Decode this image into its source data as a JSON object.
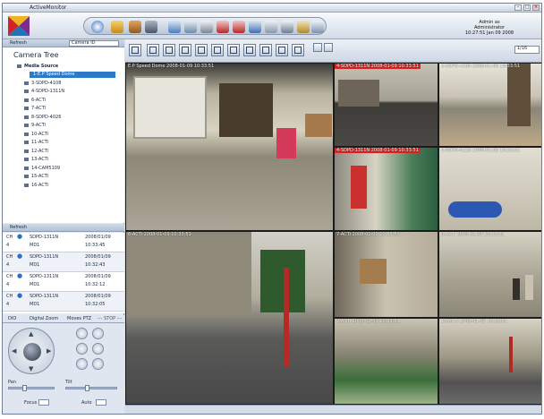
{
  "app": {
    "title": "ActiveMonitor"
  },
  "header": {
    "admin_line1": "Admin as Administrator",
    "admin_line2": "10:27:51 Jan 09 2008"
  },
  "sidebar": {
    "refresh_label": "Refresh",
    "camera_select": "Camera ID",
    "tree_title": "Camera Tree",
    "tree": [
      "Media Source",
      "1-E.P Speed Dome",
      "3-SDPD-4108",
      "4-SDPD-1311N",
      "6-ACTi",
      "7-ACTi",
      "8-SDPD-4026",
      "9-ACTi",
      "10-ACTi",
      "11-ACTi",
      "12-ACTi",
      "13-ACTi",
      "14-CAM5109",
      "15-ACTi",
      "16-ACTi"
    ]
  },
  "events": {
    "refresh_label": "Refresh",
    "rows": [
      {
        "ch": "CH",
        "name": "SDPD-1311N",
        "date": "2008/01/09",
        "num": "4",
        "md": "MD1",
        "time": "10:33:45"
      },
      {
        "ch": "CH",
        "name": "SDPD-1311N",
        "date": "2008/01/09",
        "num": "4",
        "md": "MD1",
        "time": "10:32:43"
      },
      {
        "ch": "CH",
        "name": "SDPD-1311N",
        "date": "2008/01/09",
        "num": "4",
        "md": "MD1",
        "time": "10:32:12"
      },
      {
        "ch": "CH",
        "name": "SDPD-1311N",
        "date": "2008/01/09",
        "num": "4",
        "md": "MD1",
        "time": "10:32:05"
      }
    ]
  },
  "ptz": {
    "tabs": [
      "DIO",
      "Digital Zoom",
      "Moves PTZ"
    ],
    "stop_label": "--- STOP ---",
    "slider1": "Pan",
    "slider2": "Tilt",
    "focus_label": "Focus",
    "auto_label": "Auto",
    "speed_label": "Speed"
  },
  "video_toolbar": {
    "page_select": "1/16"
  },
  "cameras": [
    {
      "label": "E.P Speed Dome  2008-01-09 10:33:51",
      "red": false
    },
    {
      "label": "4-SDPD-1311N  2008-01-09 10:33:51",
      "red": true
    },
    {
      "label": "3-SDPD-4108  2008-01-09 10:33:51",
      "red": false
    },
    {
      "label": "4-SDPD-1311N  2008-01-09 10:33:51",
      "red": true
    },
    {
      "label": "5-SDPD-6126  2008-01-09 10:33:51",
      "red": false
    },
    {
      "label": "6-ACTi  2008-01-09 10:33:51",
      "red": false
    },
    {
      "label": "7-ACTi  2008-01-09 10:33:50",
      "red": false
    },
    {
      "label": "8-ACTi  2008-01-09 10:33:51",
      "red": false
    },
    {
      "label": "9-ACTi  2008-01-09 10:33:51",
      "red": false
    },
    {
      "label": "10-ACTi  2008-01-09 10:33:51",
      "red": false
    },
    {
      "label": "11-ACTi  2008-01-09 10:33:51",
      "red": false
    }
  ],
  "colors": {
    "accent": "#2e78c8",
    "alarm": "#d9231f"
  }
}
